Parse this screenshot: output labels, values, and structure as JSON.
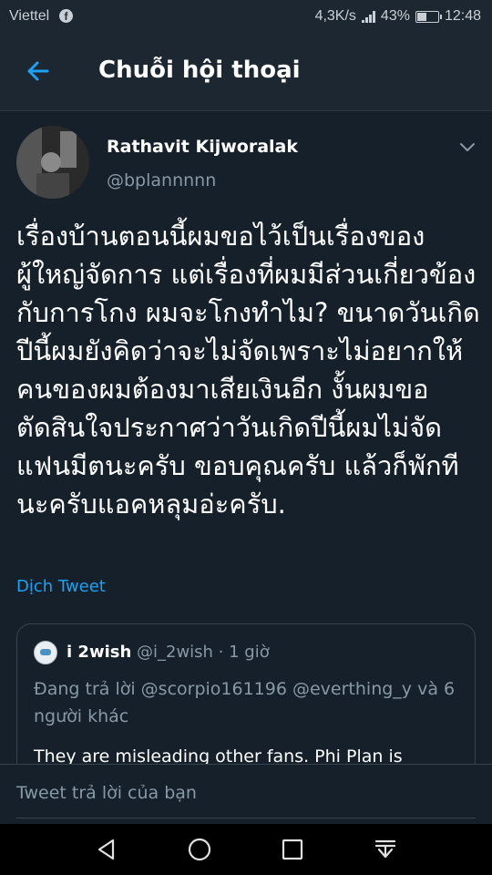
{
  "status_bar": {
    "carrier": "Viettel",
    "speed": "4,3K/s",
    "battery": "43%",
    "time": "12:48"
  },
  "header": {
    "title": "Chuỗi hội thoại"
  },
  "tweet": {
    "author_name": "Rathavit Kijworalak",
    "author_handle": "@bplannnnn",
    "text": "เรื่องบ้านตอนนี้ผมขอไว้เป็นเรื่องของผู้ใหญ่จัดการ แต่เรื่องที่ผมมีส่วนเกี่ยวข้องกับการโกง ผมจะโกงทำไม? ขนาดวันเกิดปีนี้ผมยังคิดว่าจะไม่จัดเพราะไม่อยากให้คนของผมต้องมาเสียเงินอีก งั้นผมขอตัดสินใจประกาศว่าวันเกิดปีนี้ผมไม่จัดแฟนมีตนะครับ ขอบคุณครับ แล้วก็พักทีนะครับแอคหลุมอ่ะครับ.",
    "translate_label": "Dịch Tweet"
  },
  "quoted_tweet": {
    "name": "i 2wish",
    "handle_time": "@i_2wish · 1 giờ",
    "reply_info": "Đang trả lời @scorpio161196 @everthing_y và 6 người khác",
    "body": "They are misleading other fans. Phi Plan is"
  },
  "reply_bar": {
    "placeholder": "Tweet trả lời của bạn"
  },
  "icons": {
    "back": "arrow-left-icon",
    "more": "chevron-down-icon",
    "nav_back": "triangle-back-icon",
    "nav_home": "circle-home-icon",
    "nav_recents": "square-recents-icon",
    "nav_notifications": "pull-down-icon"
  },
  "colors": {
    "background": "#15202b",
    "header": "#1c2732",
    "accent": "#1da1f2",
    "secondary_text": "#8899a6"
  }
}
